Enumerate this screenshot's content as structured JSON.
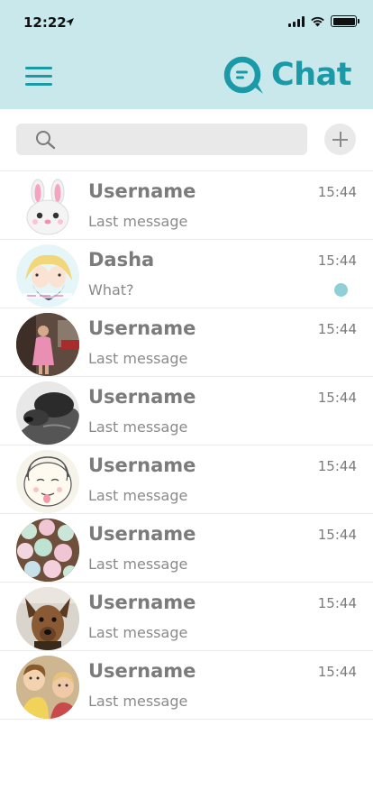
{
  "status_bar": {
    "time": "12:22"
  },
  "header": {
    "logo_text": "Chat",
    "accent_color": "#1a9aa7",
    "background": "#c8e8ec"
  },
  "search": {
    "placeholder": ""
  },
  "chats": [
    {
      "name": "Username",
      "last_message": "Last message",
      "time": "15:44",
      "unread": false,
      "avatar": "bunny-emoji"
    },
    {
      "name": "Dasha",
      "last_message": "What?",
      "time": "15:44",
      "unread": true,
      "avatar": "anime-couple"
    },
    {
      "name": "Username",
      "last_message": "Last message",
      "time": "15:44",
      "unread": false,
      "avatar": "woman-pink-dress"
    },
    {
      "name": "Username",
      "last_message": "Last message",
      "time": "15:44",
      "unread": false,
      "avatar": "sleeping-dog-bw"
    },
    {
      "name": "Username",
      "last_message": "Last message",
      "time": "15:44",
      "unread": false,
      "avatar": "cartoon-face"
    },
    {
      "name": "Username",
      "last_message": "Last message",
      "time": "15:44",
      "unread": false,
      "avatar": "cupcakes"
    },
    {
      "name": "Username",
      "last_message": "Last message",
      "time": "15:44",
      "unread": false,
      "avatar": "brown-dog"
    },
    {
      "name": "Username",
      "last_message": "Last message",
      "time": "15:44",
      "unread": false,
      "avatar": "kids-photo"
    }
  ]
}
